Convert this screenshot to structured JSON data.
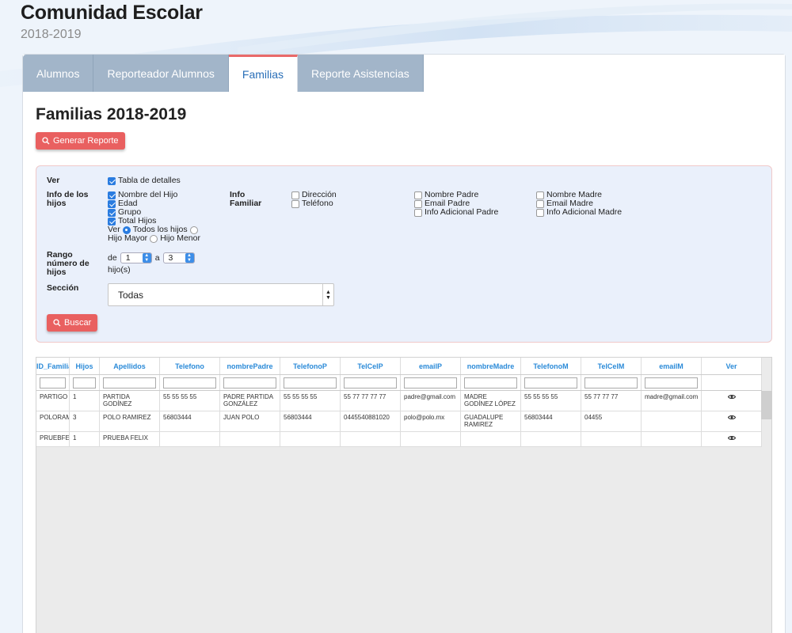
{
  "app": {
    "title": "Comunidad Escolar",
    "subtitle": "2018-2019"
  },
  "tabs": [
    {
      "label": "Alumnos",
      "active": false
    },
    {
      "label": "Reporteador Alumnos",
      "active": false
    },
    {
      "label": "Familias",
      "active": true
    },
    {
      "label": "Reporte Asistencias",
      "active": false
    }
  ],
  "page": {
    "title": "Familias 2018-2019",
    "generate_report_label": "Generar Reporte"
  },
  "filters": {
    "ver_label": "Ver",
    "tabla_detalles": "Tabla de detalles",
    "info_hijos_label": "Info de los hijos",
    "hijos_options": [
      "Nombre del Hijo",
      "Edad",
      "Grupo",
      "Total Hijos"
    ],
    "ver_prefix": "Ver",
    "radio_options": [
      "Todos los hijos",
      "Hijo Mayor",
      "Hijo Menor"
    ],
    "info_familiar_label": "Info Familiar",
    "familiar_options": [
      "Dirección",
      "Teléfono"
    ],
    "padre_options": [
      "Nombre Padre",
      "Email Padre",
      "Info Adicional Padre"
    ],
    "madre_options": [
      "Nombre Madre",
      "Email Madre",
      "Info Adicional Madre"
    ],
    "rango_label": "Rango número de hijos",
    "rango_de": "de",
    "rango_from": "1",
    "rango_a": "a",
    "rango_to": "3",
    "rango_suffix": "hijo(s)",
    "seccion_label": "Sección",
    "seccion_value": "Todas",
    "buscar_label": "Buscar"
  },
  "table": {
    "columns": [
      "ID_Familia",
      "Hijos",
      "Apellidos",
      "Telefono",
      "nombrePadre",
      "TelefonoP",
      "TelCelP",
      "emailP",
      "nombreMadre",
      "TelefonoM",
      "TelCelM",
      "emailM",
      "Ver"
    ],
    "rows": [
      [
        "PARTIGO",
        "1",
        "PARTIDA GODÍNEZ",
        "55 55 55 55",
        "PADRE PARTIDA GONZÁLEZ",
        "55 55 55 55",
        "55 77 77 77 77",
        "padre@gmail.com",
        "MADRE GODÍNEZ LÓPEZ",
        "55 55 55 55",
        "55 77 77 77",
        "madre@gmail.com"
      ],
      [
        "POLORAM",
        "3",
        "POLO RAMIREZ",
        "56803444",
        "JUAN POLO",
        "56803444",
        "0445540881020",
        "polo@polo.mx",
        "GUADALUPE RAMIREZ",
        "56803444",
        "04455",
        ""
      ],
      [
        "PRUEBFE",
        "1",
        "PRUEBA FELIX",
        "",
        "",
        "",
        "",
        "",
        "",
        "",
        "",
        ""
      ]
    ]
  }
}
